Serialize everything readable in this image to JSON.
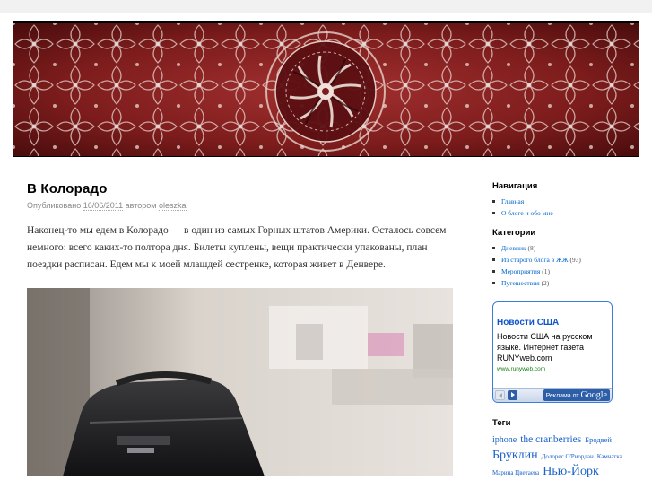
{
  "post": {
    "title": "В Колорадо",
    "meta_prefix": "Опубликовано",
    "date": "16/06/2011",
    "meta_author_prefix": "автором",
    "author": "oleszka",
    "body": "Наконец-то мы едем в Колорадо — в один из самых Горных штатов Америки. Осталось совсем немного: всего каких-то полтора дня. Билеты куплены, вещи практически упакованы, план поездки расписан. Едем мы к моей млашдей сестренке, которая живет в Денвере."
  },
  "sidebar": {
    "nav_title": "Навигация",
    "nav_items": [
      {
        "label": "Главная"
      },
      {
        "label": "О блоге и обо мне"
      }
    ],
    "cat_title": "Категории",
    "categories": [
      {
        "label": "Дневник",
        "count": "(8)"
      },
      {
        "label": "Из старого блога в ЖЖ",
        "count": "(93)"
      },
      {
        "label": "Мероприятия",
        "count": "(1)"
      },
      {
        "label": "Путешествия",
        "count": "(2)"
      }
    ]
  },
  "ad": {
    "title": "Новости США",
    "text": "Новости США на русском языке. Интернет газета RUNYweb.com",
    "url": "www.runyweb.com",
    "by_label": "Реклама от",
    "by_brand": "Google"
  },
  "tags": {
    "title": "Теги",
    "items": [
      {
        "label": "iphone",
        "size": "10px"
      },
      {
        "label": "the cranberries",
        "size": "11.5px"
      },
      {
        "label": "Бродвей",
        "size": "8.5px"
      },
      {
        "label": "Бруклин",
        "size": "14px"
      },
      {
        "label": "Долорес О'Риордан",
        "size": "7px"
      },
      {
        "label": "Камчатка",
        "size": "7px"
      },
      {
        "label": "Марина Цветаева",
        "size": "7px"
      },
      {
        "label": "Нью-Йорк",
        "size": "14px"
      }
    ]
  },
  "colors": {
    "link": "#0066cc",
    "banner_red": "#7a1a1a",
    "ad_border": "#3b7dd8"
  }
}
